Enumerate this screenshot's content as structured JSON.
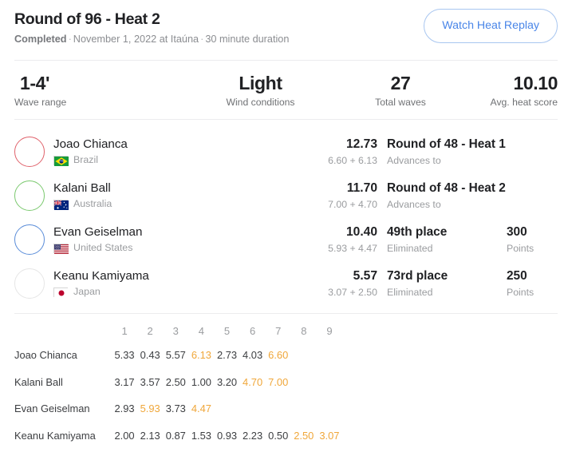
{
  "header": {
    "title": "Round of 96 - Heat 2",
    "status": "Completed",
    "separator": "·",
    "date_location": "November 1, 2022 at Itaúna",
    "duration": "30 minute duration",
    "replay_button": "Watch Heat Replay"
  },
  "stats": [
    {
      "value": "1-4'",
      "label": "Wave range"
    },
    {
      "value": "Light",
      "label": "Wind conditions"
    },
    {
      "value": "27",
      "label": "Total waves"
    },
    {
      "value": "10.10",
      "label": "Avg. heat score"
    }
  ],
  "athletes": [
    {
      "name": "Joao Chianca",
      "country": "Brazil",
      "flag": "brazil-flag",
      "ring_color": "#e0636c",
      "total": "12.73",
      "breakdown": "6.60 + 6.13",
      "result": "Round of 48 - Heat 1",
      "result_sub": "Advances to",
      "points": "",
      "points_label": ""
    },
    {
      "name": "Kalani Ball",
      "country": "Australia",
      "flag": "australia-flag",
      "ring_color": "#7bc96f",
      "total": "11.70",
      "breakdown": "7.00 + 4.70",
      "result": "Round of 48 - Heat 2",
      "result_sub": "Advances to",
      "points": "",
      "points_label": ""
    },
    {
      "name": "Evan Geiselman",
      "country": "United States",
      "flag": "usa-flag",
      "ring_color": "#5b8dd9",
      "total": "10.40",
      "breakdown": "5.93 + 4.47",
      "result": "49th place",
      "result_sub": "Eliminated",
      "points": "300",
      "points_label": "Points"
    },
    {
      "name": "Keanu Kamiyama",
      "country": "Japan",
      "flag": "japan-flag",
      "ring_color": "#e6e6e6",
      "total": "5.57",
      "breakdown": "3.07 + 2.50",
      "result": "73rd place",
      "result_sub": "Eliminated",
      "points": "250",
      "points_label": "Points"
    }
  ],
  "wave_table": {
    "columns": [
      "1",
      "2",
      "3",
      "4",
      "5",
      "6",
      "7",
      "8",
      "9"
    ],
    "highlight_color": "#f0a73a",
    "rows": [
      {
        "name": "Joao Chianca",
        "scores": [
          "5.33",
          "0.43",
          "5.57",
          "6.13",
          "2.73",
          "4.03",
          "6.60",
          "",
          ""
        ],
        "counted": [
          false,
          false,
          false,
          true,
          false,
          false,
          true,
          false,
          false
        ]
      },
      {
        "name": "Kalani Ball",
        "scores": [
          "3.17",
          "3.57",
          "2.50",
          "1.00",
          "3.20",
          "4.70",
          "7.00",
          "",
          ""
        ],
        "counted": [
          false,
          false,
          false,
          false,
          false,
          true,
          true,
          false,
          false
        ]
      },
      {
        "name": "Evan Geiselman",
        "scores": [
          "2.93",
          "5.93",
          "3.73",
          "4.47",
          "",
          "",
          "",
          "",
          ""
        ],
        "counted": [
          false,
          true,
          false,
          true,
          false,
          false,
          false,
          false,
          false
        ]
      },
      {
        "name": "Keanu Kamiyama",
        "scores": [
          "2.00",
          "2.13",
          "0.87",
          "1.53",
          "0.93",
          "2.23",
          "0.50",
          "2.50",
          "3.07"
        ],
        "counted": [
          false,
          false,
          false,
          false,
          false,
          false,
          false,
          true,
          true
        ]
      }
    ]
  }
}
